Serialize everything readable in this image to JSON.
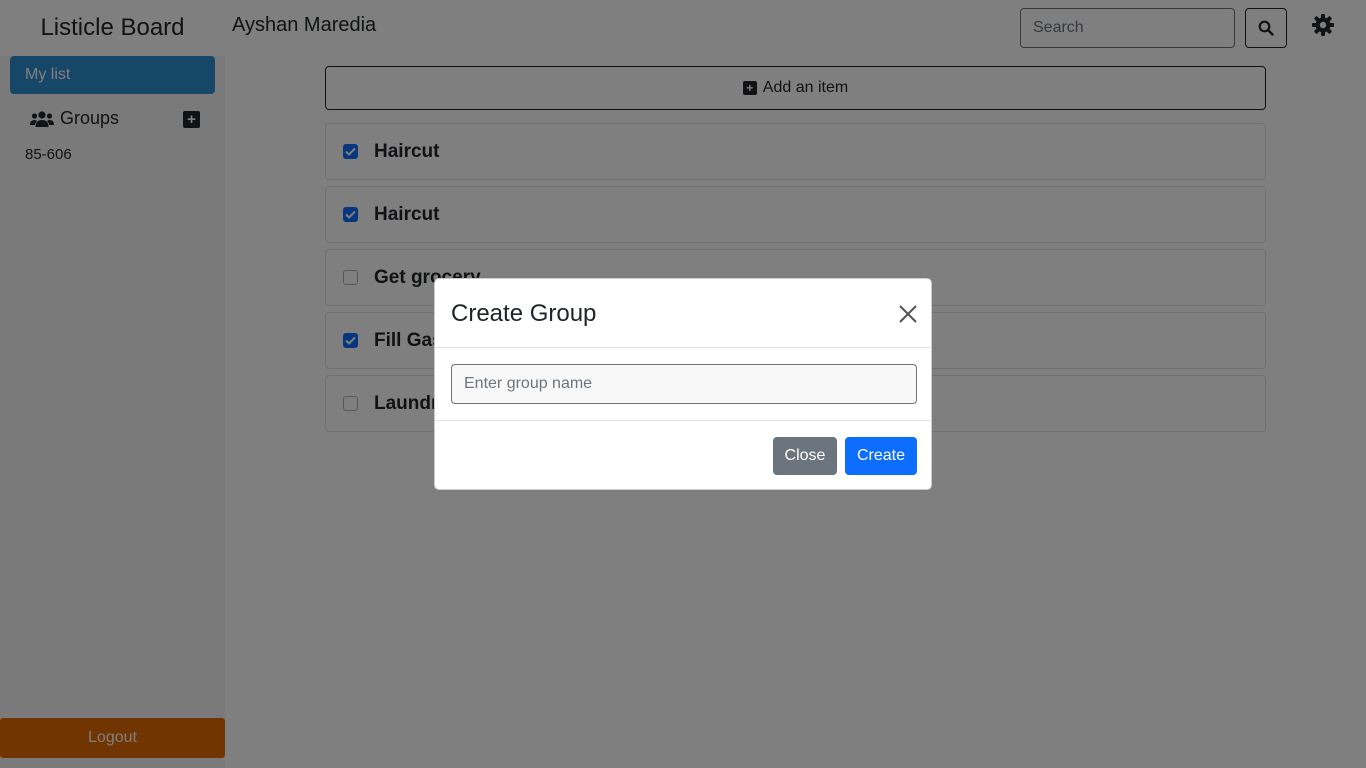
{
  "header": {
    "brand": "Listicle Board",
    "username": "Ayshan Maredia",
    "search_placeholder": "Search",
    "search_icon": "search-icon",
    "settings_icon": "gear-icon"
  },
  "sidebar": {
    "my_list_label": "My list",
    "groups_label": "Groups",
    "groups_icon": "users-icon",
    "add_group_icon": "plus-square-icon",
    "groups": [
      "85-606"
    ],
    "logout_label": "Logout"
  },
  "main": {
    "add_item_label": "Add an item",
    "items": [
      {
        "label": "Haircut",
        "checked": true
      },
      {
        "label": "Haircut",
        "checked": true
      },
      {
        "label": "Get grocery",
        "checked": false
      },
      {
        "label": "Fill Gas",
        "checked": true
      },
      {
        "label": "Laundry",
        "checked": false
      }
    ]
  },
  "modal": {
    "title": "Create Group",
    "input_placeholder": "Enter group name",
    "input_value": "",
    "close_label": "Close",
    "create_label": "Create"
  },
  "colors": {
    "primary": "#0d6efd",
    "sidebar_active": "#2f8fd0",
    "logout": "#e06a00",
    "secondary": "#6c757d"
  }
}
